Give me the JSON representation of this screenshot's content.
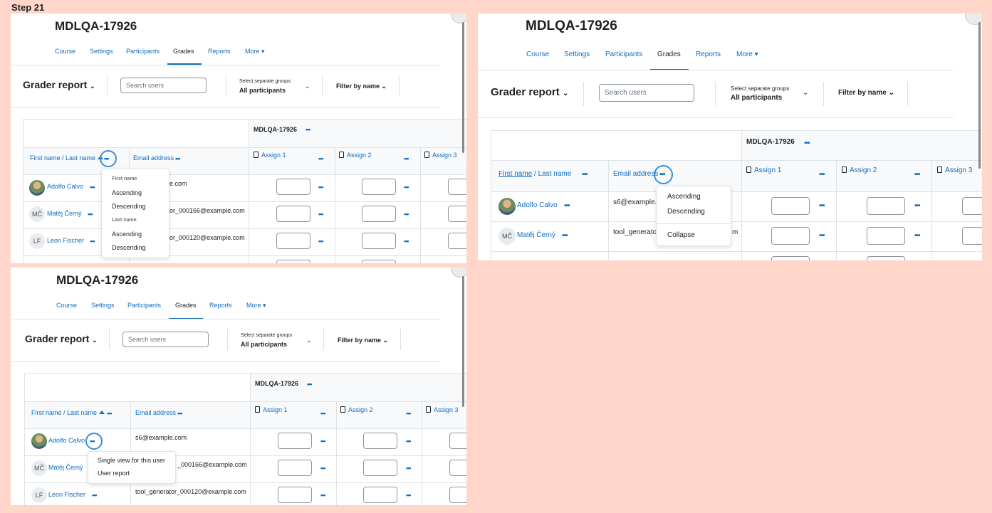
{
  "step_title": "Step 21",
  "course_title": "MDLQA-17926",
  "nav": {
    "items": [
      "Course",
      "Settings",
      "Participants",
      "Grades",
      "Reports",
      "More"
    ],
    "active": "Grades"
  },
  "report": {
    "title": "Grader report",
    "search_placeholder": "Search users",
    "groups_label": "Select separate groups",
    "groups_value": "All participants",
    "filter_label": "Filter by name"
  },
  "table": {
    "category_header": "MDLQA-17926",
    "col_name": "First name / Last name",
    "col_name_first": "First name",
    "col_name_sep": " / ",
    "col_name_last": "Last name",
    "col_email": "Email address",
    "assignments": [
      "Assign 1",
      "Assign 2",
      "Assign 3"
    ],
    "rows": [
      {
        "name": "Adolfo Calvo",
        "initials": "",
        "email": "s6@example.com"
      },
      {
        "name": "Matěj Černý",
        "initials": "MČ",
        "email": "tool_generator_000166@example.com"
      },
      {
        "name": "Leon Fischer",
        "initials": "LF",
        "email": "tool_generator_000120@example.com"
      }
    ],
    "partial_emails": {
      "p1_row1": "e.com",
      "p1_row2": "or_000166@example.com",
      "p1_row3": "or_000120@example.com",
      "p2_row1": "s6@example.",
      "p2_row2": "tool_generato",
      "p2_row2_tail": "m",
      "p3_row2": "_000166@example.com"
    }
  },
  "menus": {
    "name_sort": {
      "first_heading": "First name",
      "last_heading": "Last name",
      "ascending": "Ascending",
      "descending": "Descending"
    },
    "email_menu": {
      "ascending": "Ascending",
      "descending": "Descending",
      "collapse": "Collapse"
    },
    "user_menu": {
      "single_view": "Single view for this user",
      "user_report": "User report"
    }
  },
  "dots_glyph": "•••",
  "more_caret": "▾",
  "colors": {
    "background": "#ffd6c9",
    "link": "#0f6cbf",
    "focus": "#3a8fd4"
  }
}
